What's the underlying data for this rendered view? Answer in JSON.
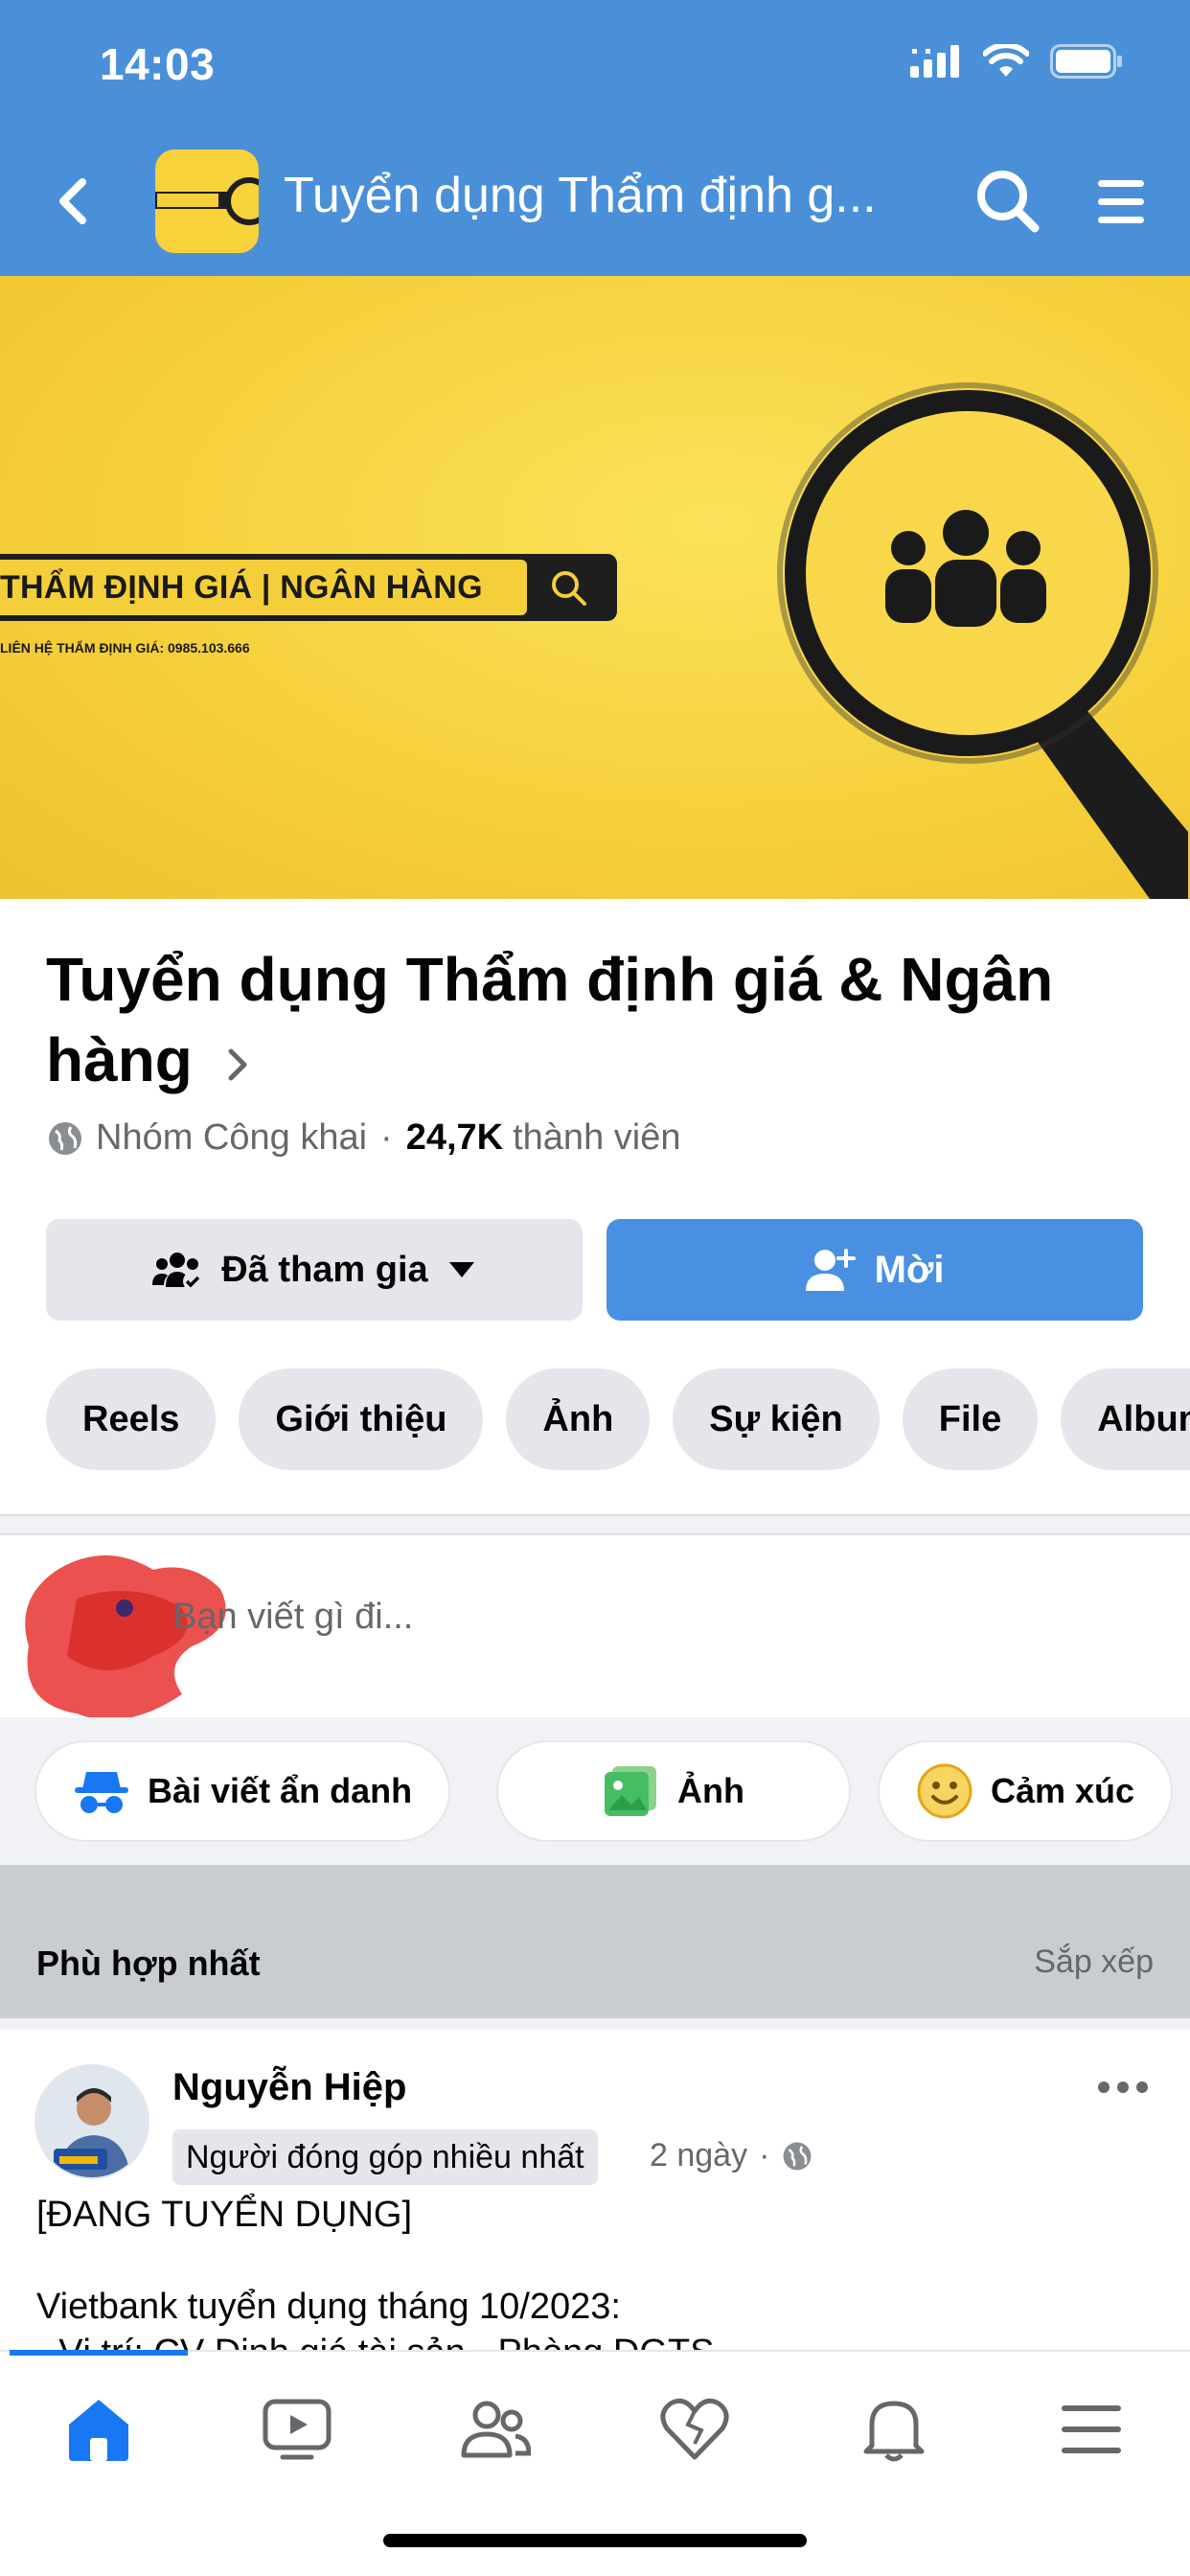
{
  "status_bar": {
    "time": "14:03"
  },
  "header": {
    "title": "Tuyển dụng Thẩm định g..."
  },
  "cover": {
    "banner_text": "THẨM ĐỊNH GIÁ | NGÂN HÀNG",
    "contact_text": "LIÊN HỆ THẨM ĐỊNH GIÁ: 0985.103.666"
  },
  "group": {
    "name": "Tuyển dụng Thẩm định giá & Ngân hàng",
    "privacy": "Nhóm Công khai",
    "separator": "·",
    "member_count": "24,7K",
    "member_label": "thành viên"
  },
  "actions": {
    "joined_label": "Đã tham gia",
    "invite_label": "Mời"
  },
  "tabs": [
    "Reels",
    "Giới thiệu",
    "Ảnh",
    "Sự kiện",
    "File",
    "Album"
  ],
  "composer": {
    "placeholder": "Bạn viết gì đi...",
    "chips": [
      "Bài viết ẩn danh",
      "Ảnh",
      "Cảm xúc"
    ]
  },
  "feed": {
    "sort_title": "Phù hợp nhất",
    "sort_button": "Sắp xếp"
  },
  "post": {
    "author": "Nguyễn Hiệp",
    "badge": "Người đóng góp nhiều nhất",
    "time": "2 ngày",
    "dot": "·",
    "line1": "[ĐANG TUYỂN DỤNG]",
    "line2": "Vietbank tuyển dụng tháng 10/2023:",
    "line3": "- Vị trí: CV Định giá tài sản - Phòng DGTS"
  },
  "colors": {
    "header_blue": "#4a90d9",
    "accent_blue": "#4a90e2",
    "cover_yellow": "#f5cf3a"
  },
  "bottom_nav": [
    "home-icon",
    "video-icon",
    "groups-icon",
    "dating-icon",
    "notifications-icon",
    "menu-icon"
  ]
}
